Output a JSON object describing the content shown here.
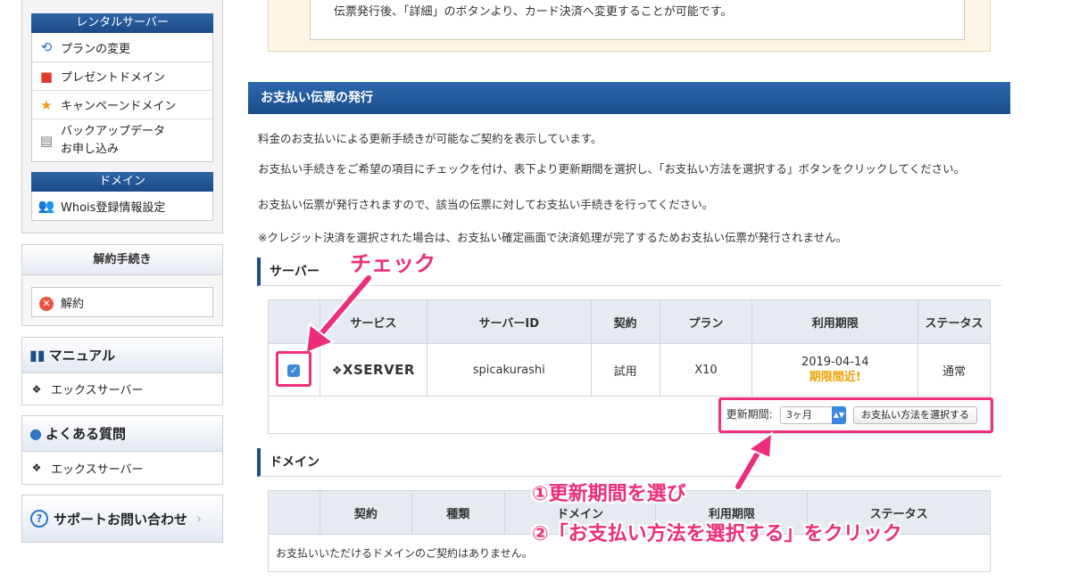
{
  "sidebar": {
    "rental": {
      "header": "レンタルサーバー",
      "items": [
        {
          "icon": "refresh-arrows-icon",
          "label": "プランの変更"
        },
        {
          "icon": "gift-icon",
          "label": "プレゼントドメイン"
        },
        {
          "icon": "star-icon",
          "label": "キャンペーンドメイン"
        },
        {
          "icon": "server-icon",
          "label": "バックアップデータ",
          "label2": "お申し込み"
        }
      ]
    },
    "domain": {
      "header": "ドメイン",
      "items": [
        {
          "icon": "users-icon",
          "label": "Whois登録情報設定"
        }
      ]
    },
    "cancel": {
      "header": "解約手続き",
      "item": "解約"
    },
    "manual": {
      "header": "マニュアル",
      "item": "エックスサーバー"
    },
    "faq": {
      "header": "よくある質問",
      "item": "エックスサーバー"
    },
    "support": {
      "header": "サポートお問い合わせ"
    }
  },
  "notice": {
    "text": "伝票発行後、「詳細」のボタンより、カード決済へ変更することが可能です。"
  },
  "main": {
    "section_title": "お支払い伝票の発行",
    "para1": "料金のお支払いによる更新手続きが可能なご契約を表示しています。",
    "para2": "お支払い手続きをご希望の項目にチェックを付け、表下より更新期間を選択し、「お支払い方法を選択する」ボタンをクリックしてください。",
    "para3": "お支払い伝票が発行されますので、該当の伝票に対してお支払い手続きを行ってください。",
    "para4": "※クレジット決済を選択された場合は、お支払い確定画面で決済処理が完了するためお支払い伝票が発行されません。",
    "server": {
      "heading": "サーバー",
      "columns": [
        "",
        "サービス",
        "サーバーID",
        "契約",
        "プラン",
        "利用期限",
        "ステータス"
      ],
      "row": {
        "service": "XSERVER",
        "server_id": "spicakurashi",
        "contract": "試用",
        "plan": "X10",
        "expiry": "2019-04-14",
        "expiry_warning": "期限間近!",
        "status": "通常"
      },
      "period_label": "更新期間:",
      "period_value": "3ヶ月",
      "submit_label": "お支払い方法を選択する"
    },
    "domain": {
      "heading": "ドメイン",
      "columns": [
        "",
        "契約",
        "種類",
        "ドメイン",
        "利用期限",
        "ステータス"
      ],
      "empty": "お支払いいただけるドメインのご契約はありません。"
    }
  },
  "annotations": {
    "check": "チェック",
    "step1": "①更新期間を選び",
    "step2": "②「お支払い方法を選択する」をクリック"
  },
  "colors": {
    "accent": "#1b4d8c",
    "annotation": "#ec2d7a",
    "warning": "#f0a000"
  }
}
